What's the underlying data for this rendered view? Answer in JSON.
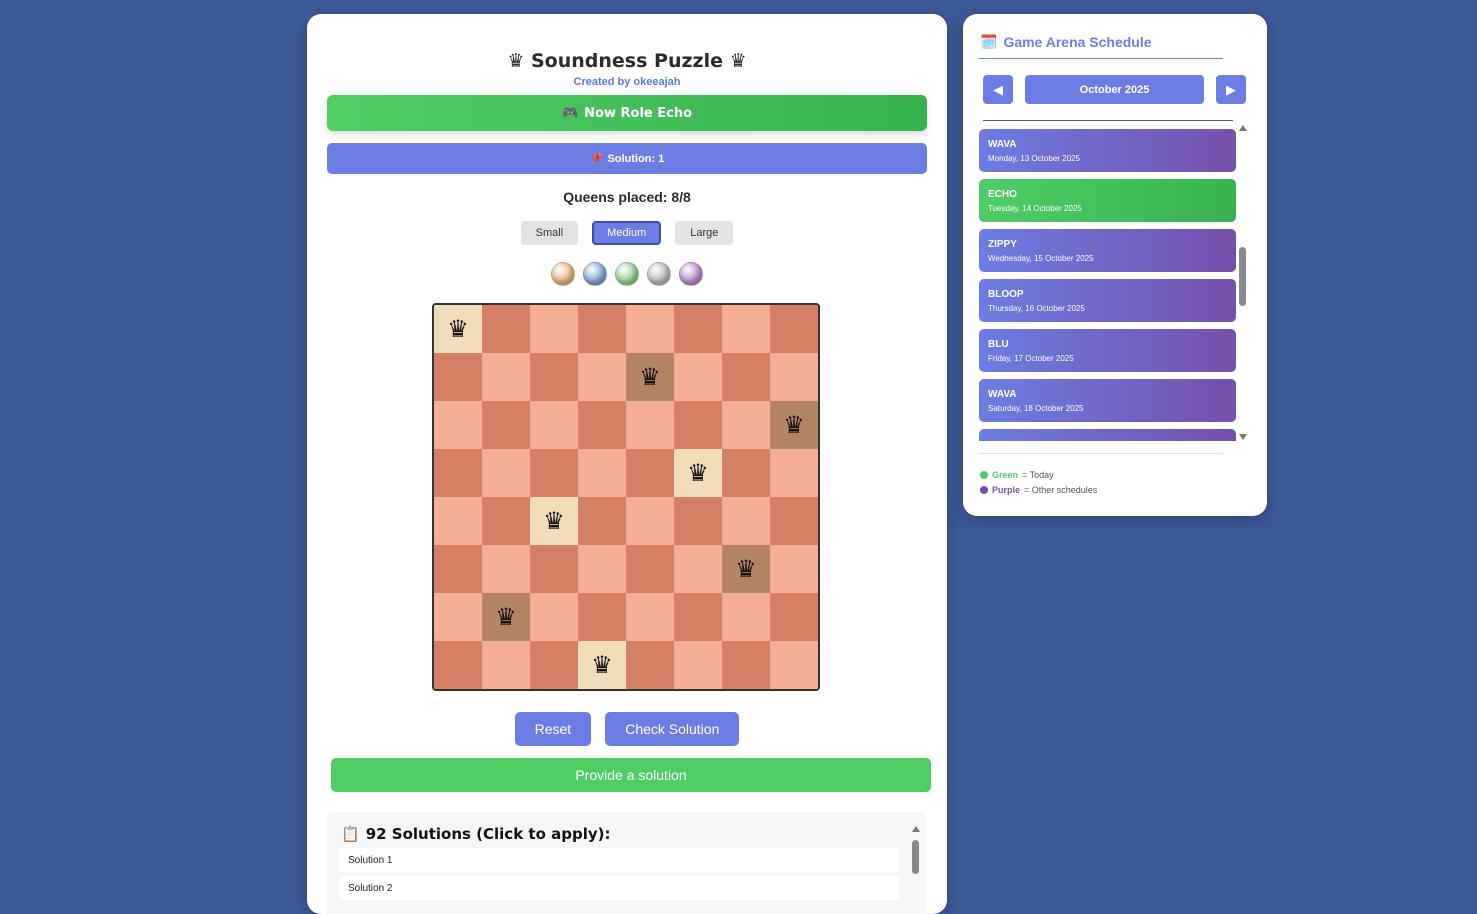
{
  "game": {
    "title": "Soundness Puzzle",
    "title_icon": "♛",
    "subtitle": "Created by okeeajah",
    "role_button": {
      "icon": "🎮",
      "label": "Now Role Echo"
    },
    "solution_bar": {
      "icon": "📌",
      "label": "Solution: 1"
    },
    "queens_placed": "Queens placed: 8/8",
    "sizes": [
      {
        "label": "Small",
        "active": false
      },
      {
        "label": "Medium",
        "active": true
      },
      {
        "label": "Large",
        "active": false
      }
    ],
    "themes": [
      {
        "name": "tan",
        "color": "#e2b07e"
      },
      {
        "name": "blue",
        "color": "#7e9fcb"
      },
      {
        "name": "green",
        "color": "#8fcb8b"
      },
      {
        "name": "gray",
        "color": "#b5b5b5"
      },
      {
        "name": "purple",
        "color": "#b389c6"
      }
    ],
    "board": {
      "size": 8,
      "queen_symbol": "♛",
      "queens": [
        [
          0,
          0
        ],
        [
          1,
          4
        ],
        [
          2,
          7
        ],
        [
          3,
          5
        ],
        [
          4,
          2
        ],
        [
          5,
          6
        ],
        [
          6,
          1
        ],
        [
          7,
          3
        ]
      ]
    },
    "buttons": {
      "reset": "Reset",
      "check": "Check Solution",
      "provide": "Provide a solution"
    },
    "solutions": {
      "icon": "📋",
      "title": "92 Solutions (Click to apply):",
      "items": [
        "Solution 1",
        "Solution 2"
      ]
    }
  },
  "schedule": {
    "icon": "🗓️",
    "title": "Game Arena Schedule",
    "month": "October 2025",
    "prev_icon": "◀",
    "next_icon": "▶",
    "items": [
      {
        "name": "WAVA",
        "date": "Monday, 13 October 2025",
        "kind": "purple"
      },
      {
        "name": "ECHO",
        "date": "Tuesday, 14 October 2025",
        "kind": "green"
      },
      {
        "name": "ZIPPY",
        "date": "Wednesday, 15 October 2025",
        "kind": "purple"
      },
      {
        "name": "BLOOP",
        "date": "Thursday, 16 October 2025",
        "kind": "purple"
      },
      {
        "name": "BLU",
        "date": "Friday, 17 October 2025",
        "kind": "purple"
      },
      {
        "name": "WAVA",
        "date": "Saturday, 18 October 2025",
        "kind": "purple"
      },
      {
        "name": "",
        "date": "",
        "kind": "purple"
      }
    ],
    "legend": [
      {
        "key": "Green",
        "text": "= Today",
        "color": "#4ecd66"
      },
      {
        "key": "Purple",
        "text": "= Other schedules",
        "color": "#7650ab"
      }
    ]
  }
}
